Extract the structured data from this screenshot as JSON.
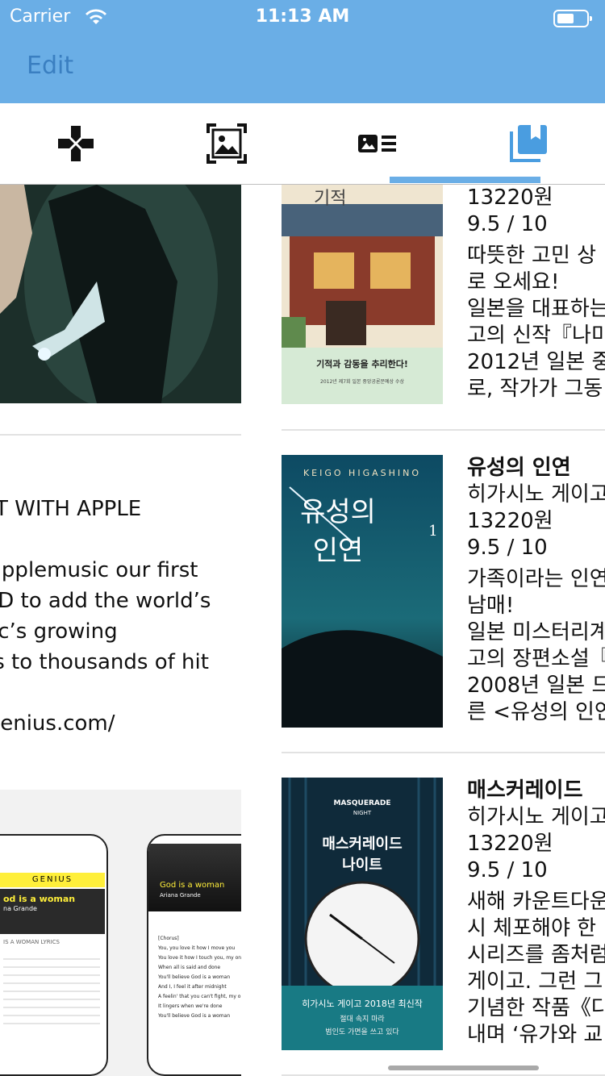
{
  "status": {
    "carrier": "Carrier",
    "time": "11:13 AM"
  },
  "nav": {
    "edit": "Edit"
  },
  "tabs": [
    {
      "name": "tab-games",
      "icon": "gamepad-icon"
    },
    {
      "name": "tab-photos",
      "icon": "photo-frame-icon"
    },
    {
      "name": "tab-articles",
      "icon": "article-list-icon"
    },
    {
      "name": "tab-books",
      "icon": "book-stack-icon",
      "selected": true
    }
  ],
  "left": {
    "article_lines": [
      "ART WITH APPLE",
      "",
      "@applemusic our first",
      "AND to add the world’s",
      "usic’s growing",
      "rics to thousands of hit",
      "",
      "o.genius.com/"
    ],
    "phone1": {
      "brand": "GENIUS",
      "song": "od is a woman",
      "artist": "na Grande",
      "section": "IS A WOMAN LYRICS"
    },
    "phone2": {
      "song": "God is a woman",
      "artist": "Ariana Grande",
      "lines": [
        "[Chorus]",
        "You, you love it how I move you",
        "You love it how I touch you, my one",
        "When all is said and done",
        "You'll believe God is a woman",
        "And I, I feel it after midnight",
        "A feelin' that you can't fight, my one",
        "It lingers when we're done",
        "You'll believe God is a woman"
      ]
    }
  },
  "books": [
    {
      "cover_title": "기적",
      "cover_tagline": "기적과 감동을 추리한다!",
      "cover_sub": "2012년 제7회 일본 중앙공론문예상 수상",
      "title": "",
      "author": "",
      "price": "13220원",
      "rating": "9.5 / 10",
      "desc": [
        "따뜻한 고민 상",
        "로 오세요!",
        "일본을 대표하는",
        "고의 신작『나미",
        "2012년 일본 중",
        "로, 작가가 그동"
      ]
    },
    {
      "cover_title": "유성의 인연",
      "cover_author_en": "KEIGO HIGASHINO",
      "cover_volume": "1",
      "title": "유성의 인연",
      "author": "히가시노 게이고",
      "price": "13220원",
      "rating": "9.5 / 10",
      "desc": [
        "가족이라는 인연",
        "남매!",
        "일본 미스터리계",
        "고의 장편소설『",
        "2008년 일본 드",
        "른 <유성의 인연"
      ]
    },
    {
      "cover_title": "매스커레이드 나이트",
      "cover_en": "MASQUERADE",
      "cover_en2": "NIGHT",
      "cover_bottom": "히가시노 게이고 2018년 최신작",
      "cover_bottom2": "절대 속지 마라",
      "cover_bottom3": "범인도 가면을 쓰고 있다",
      "title": "매스커레이드",
      "author": "히가시노 게이고",
      "price": "13220원",
      "rating": "9.5 / 10",
      "desc": [
        "새해 카운트다운",
        "시 체포해야 한",
        "시리즈를 좀처럼",
        "게이고. 그런 그",
        "기념한 작품《다",
        "내며 ‘유가와 교"
      ]
    }
  ]
}
